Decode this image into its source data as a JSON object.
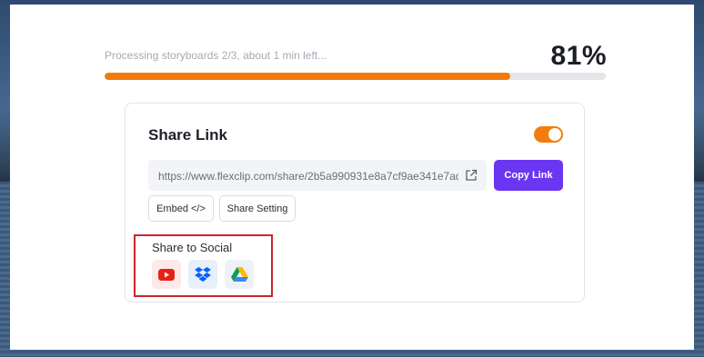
{
  "progress": {
    "status_text": "Processing storyboards 2/3, about 1 min left...",
    "percent_label": "81%",
    "value": 0.81
  },
  "share_link": {
    "title": "Share Link",
    "enabled": true,
    "url": "https://www.flexclip.com/share/2b5a990931e8a7cf9ae341e7ad1...",
    "copy_label": "Copy Link",
    "embed_label": "Embed </>",
    "setting_label": "Share Setting"
  },
  "social": {
    "title": "Share to Social",
    "items": [
      {
        "name": "youtube-icon"
      },
      {
        "name": "dropbox-icon"
      },
      {
        "name": "google-drive-icon"
      }
    ]
  },
  "colors": {
    "accent_orange": "#f27d0c",
    "primary_purple": "#6a36f2",
    "highlight_red": "#c9252d"
  }
}
